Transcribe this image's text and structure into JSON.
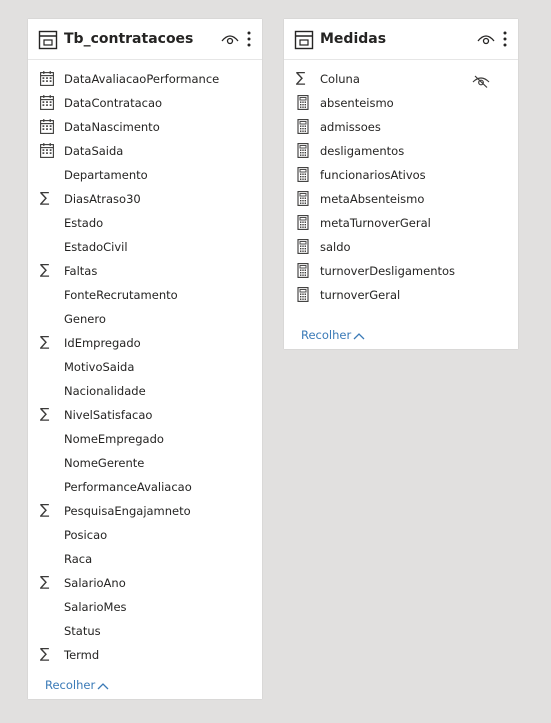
{
  "tables": [
    {
      "title": "Tb_contratacoes",
      "collapse_label": "Recolher",
      "fields": [
        {
          "label": "DataAvaliacaoPerformance",
          "icon": "calendar-icon"
        },
        {
          "label": "DataContratacao",
          "icon": "calendar-icon"
        },
        {
          "label": "DataNascimento",
          "icon": "calendar-icon"
        },
        {
          "label": "DataSaida",
          "icon": "calendar-icon"
        },
        {
          "label": "Departamento",
          "icon": "none"
        },
        {
          "label": "DiasAtraso30",
          "icon": "sigma-icon"
        },
        {
          "label": "Estado",
          "icon": "none"
        },
        {
          "label": "EstadoCivil",
          "icon": "none"
        },
        {
          "label": "Faltas",
          "icon": "sigma-icon"
        },
        {
          "label": "FonteRecrutamento",
          "icon": "none"
        },
        {
          "label": "Genero",
          "icon": "none"
        },
        {
          "label": "IdEmpregado",
          "icon": "sigma-icon"
        },
        {
          "label": "MotivoSaida",
          "icon": "none"
        },
        {
          "label": "Nacionalidade",
          "icon": "none"
        },
        {
          "label": "NivelSatisfacao",
          "icon": "sigma-icon"
        },
        {
          "label": "NomeEmpregado",
          "icon": "none"
        },
        {
          "label": "NomeGerente",
          "icon": "none"
        },
        {
          "label": "PerformanceAvaliacao",
          "icon": "none"
        },
        {
          "label": "PesquisaEngajamneto",
          "icon": "sigma-icon"
        },
        {
          "label": "Posicao",
          "icon": "none"
        },
        {
          "label": "Raca",
          "icon": "none"
        },
        {
          "label": "SalarioAno",
          "icon": "sigma-icon"
        },
        {
          "label": "SalarioMes",
          "icon": "none"
        },
        {
          "label": "Status",
          "icon": "none"
        },
        {
          "label": "Termd",
          "icon": "sigma-icon"
        }
      ]
    },
    {
      "title": "Medidas",
      "collapse_label": "Recolher",
      "fields": [
        {
          "label": "Coluna",
          "icon": "sigma-icon",
          "hidden": true
        },
        {
          "label": "absenteismo",
          "icon": "calculator-icon"
        },
        {
          "label": "admissoes",
          "icon": "calculator-icon"
        },
        {
          "label": "desligamentos",
          "icon": "calculator-icon"
        },
        {
          "label": "funcionariosAtivos",
          "icon": "calculator-icon"
        },
        {
          "label": "metaAbsenteismo",
          "icon": "calculator-icon"
        },
        {
          "label": "metaTurnoverGeral",
          "icon": "calculator-icon"
        },
        {
          "label": "saldo",
          "icon": "calculator-icon"
        },
        {
          "label": "turnoverDesligamentos",
          "icon": "calculator-icon"
        },
        {
          "label": "turnoverGeral",
          "icon": "calculator-icon"
        }
      ]
    }
  ],
  "colors": {
    "canvas": "#e1e0df",
    "card": "#ffffff",
    "text": "#252423",
    "link": "#3a7ab7"
  }
}
